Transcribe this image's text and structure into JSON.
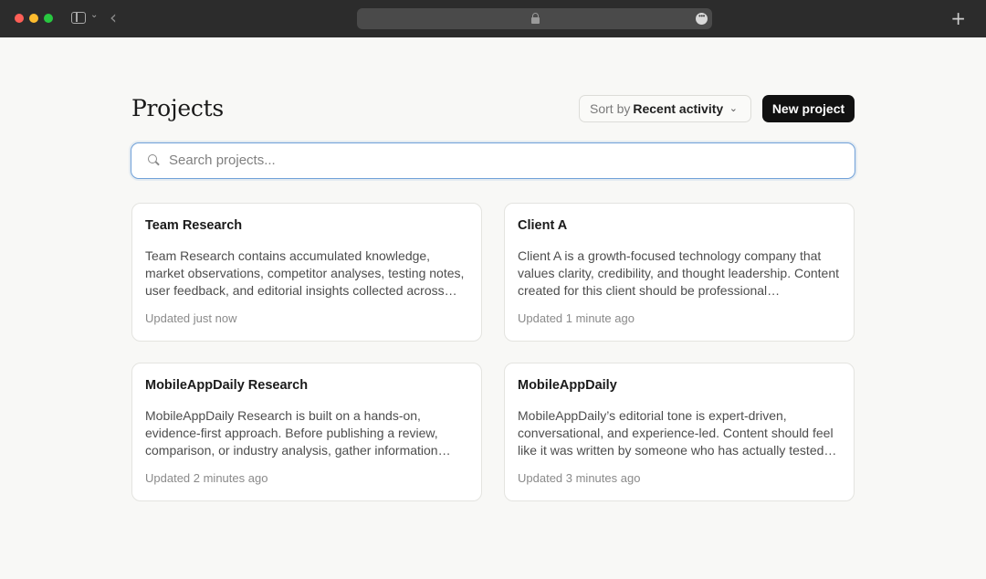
{
  "browser": {
    "chevron_down": "⌄",
    "back": "‹",
    "new_tab": "+",
    "more": "•••"
  },
  "page": {
    "title": "Projects"
  },
  "toolbar": {
    "sort_prefix": "Sort by",
    "sort_value": "Recent activity",
    "sort_chevron": "⌄",
    "new_project_label": "New project"
  },
  "search": {
    "placeholder": "Search projects...",
    "value": ""
  },
  "projects": [
    {
      "title": "Team Research",
      "description": "Team Research contains accumulated knowledge, market observations, competitor analyses, testing notes, user feedback, and editorial insights collected across…",
      "updated": "Updated just now"
    },
    {
      "title": "Client A",
      "description": "Client A is a growth-focused technology company that values clarity, credibility, and thought leadership. Content created for this client should be professional…",
      "updated": "Updated 1 minute ago"
    },
    {
      "title": "MobileAppDaily Research",
      "description": "MobileAppDaily Research is built on a hands-on, evidence-first approach. Before publishing a review, comparison, or industry analysis, gather information…",
      "updated": "Updated 2 minutes ago"
    },
    {
      "title": "MobileAppDaily",
      "description": "MobileAppDaily’s editorial tone is expert-driven, conversational, and experience-led. Content should feel like it was written by someone who has actually tested…",
      "updated": "Updated 3 minutes ago"
    }
  ],
  "colors": {
    "background": "#f8f8f6",
    "primary_button": "#111111",
    "search_focus": "#6fa0d8",
    "chrome": "#2c2c2c"
  }
}
